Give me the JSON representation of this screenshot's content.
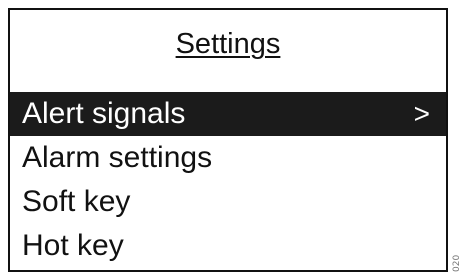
{
  "settings": {
    "title": "Settings",
    "selected_index": 0,
    "items": [
      {
        "label": "Alert signals",
        "indicator": ">"
      },
      {
        "label": "Alarm settings",
        "indicator": ""
      },
      {
        "label": "Soft key",
        "indicator": ""
      },
      {
        "label": "Hot key",
        "indicator": ""
      }
    ],
    "colors": {
      "foreground": "#111111",
      "background": "#ffffff",
      "selection": "#1b1b1b",
      "selection_text": "#ffffff"
    }
  },
  "document_code": "020"
}
